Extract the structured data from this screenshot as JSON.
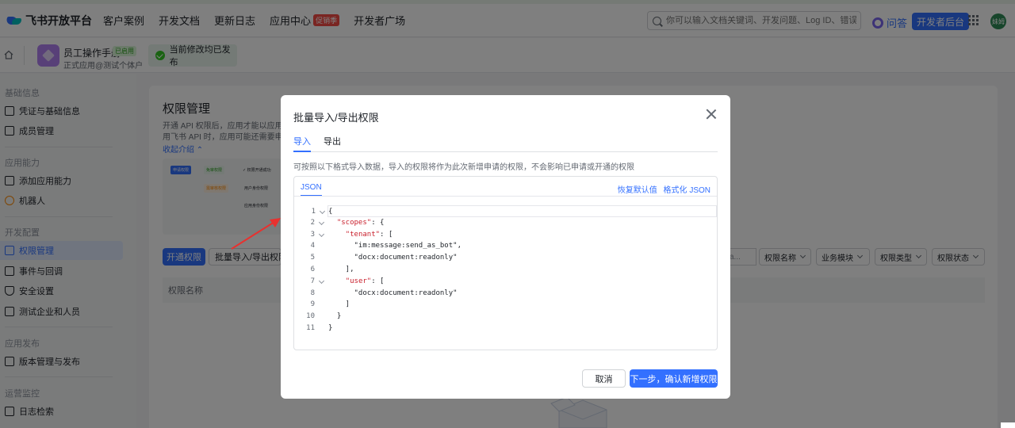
{
  "topbar": {
    "logo": "飞书开放平台",
    "nav": [
      "客户案例",
      "开发文档",
      "更新日志",
      "应用中心",
      "开发者广场"
    ],
    "hot_badge": "促销季",
    "search_placeholder": "你可以输入文档关键词、开发问题、Log ID、错误码",
    "ask": "问答",
    "dev_console": "开发者后台",
    "avatar": "妹姆"
  },
  "subbar": {
    "app_name": "员工操作手册",
    "app_status": "已启用",
    "app_sub": "正式应用@测试个体户",
    "publish_status": "当前修改均已发布"
  },
  "sidebar": {
    "sections": [
      {
        "title": "基础信息",
        "items": [
          "凭证与基础信息",
          "成员管理"
        ]
      },
      {
        "title": "应用能力",
        "items": [
          "添加应用能力",
          "机器人"
        ]
      },
      {
        "title": "开发配置",
        "items": [
          "权限管理",
          "事件与回调",
          "安全设置",
          "测试企业和人员"
        ]
      },
      {
        "title": "应用发布",
        "items": [
          "版本管理与发布"
        ]
      },
      {
        "title": "运营监控",
        "items": [
          "日志检索"
        ]
      }
    ],
    "active": "权限管理"
  },
  "page": {
    "title": "权限管理",
    "desc_lines": [
      "开通 API 权限后，应用才能以应用身",
      "用飞书 API 时，应用可能还需要申请"
    ],
    "collapse": "收起介绍",
    "preview_tags": [
      "申请权限",
      "免审权限",
      "✓ 权限开通成功",
      "需审核权限",
      "用户身份权限",
      "应用身份权限"
    ],
    "open_btn": "开通权限",
    "batch_btn": "批量导入/导出权限",
    "filter_placeholder": "a...",
    "filters": [
      "权限名称",
      "业务模块",
      "权限类型",
      "权限状态"
    ],
    "table_col": "权限名称"
  },
  "modal": {
    "title": "批量导入/导出权限",
    "tabs": [
      "导入",
      "导出"
    ],
    "active_tab": "导入",
    "note": "可按照以下格式导入数据，导入的权限将作为此次新增申请的权限，不会影响已申请或开通的权限",
    "editor_tab": "JSON",
    "links": [
      "恢复默认值",
      "格式化 JSON"
    ],
    "code": [
      {
        "n": "1",
        "fold": true,
        "t": "{"
      },
      {
        "n": "2",
        "fold": true,
        "t": "  \"scopes\": {"
      },
      {
        "n": "3",
        "fold": true,
        "t": "    \"tenant\": ["
      },
      {
        "n": "4",
        "fold": false,
        "t": "      \"im:message:send_as_bot\","
      },
      {
        "n": "5",
        "fold": false,
        "t": "      \"docx:document:readonly\""
      },
      {
        "n": "6",
        "fold": false,
        "t": "    ],"
      },
      {
        "n": "7",
        "fold": true,
        "t": "    \"user\": ["
      },
      {
        "n": "8",
        "fold": false,
        "t": "      \"docx:document:readonly\""
      },
      {
        "n": "9",
        "fold": false,
        "t": "    ]"
      },
      {
        "n": "10",
        "fold": false,
        "t": "  }"
      },
      {
        "n": "11",
        "fold": false,
        "t": "}"
      }
    ],
    "cancel": "取消",
    "next": "下一步，确认新增权限"
  },
  "colors": {
    "primary": "#3370ff",
    "active_bg": "#e1eaff",
    "arrow": "#e8312f"
  }
}
